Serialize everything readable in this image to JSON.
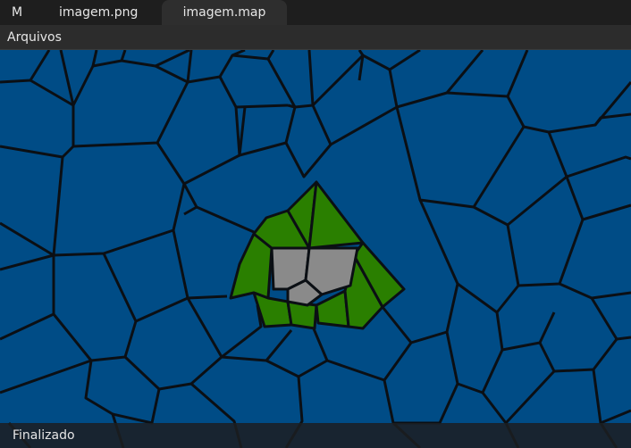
{
  "tabs": {
    "app_label": "M",
    "png_label": "imagem.png",
    "map_label": "imagem.map",
    "active": "imagem.map"
  },
  "menu": {
    "arquivos_label": "Arquivos"
  },
  "status": {
    "text": "Finalizado"
  },
  "map": {
    "colors": {
      "ocean": "#004c86",
      "land": "#2a7f00",
      "rock": "#8a8a8a",
      "edge": "#0b0f14"
    }
  }
}
